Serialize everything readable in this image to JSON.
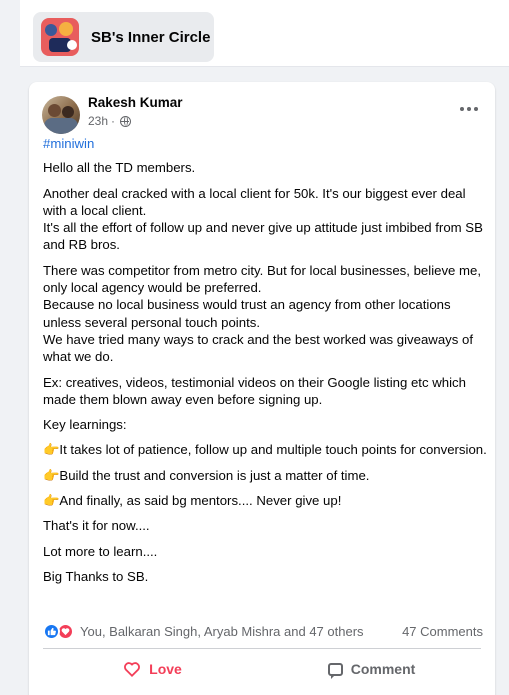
{
  "group": {
    "name": "SB's Inner Circle"
  },
  "post": {
    "author": "Rakesh Kumar",
    "time": "23h",
    "meta_separator": "·",
    "privacy_icon": "globe-icon",
    "hashtag": "#miniwin",
    "paragraphs": [
      "Hello all the TD members.",
      "Another deal cracked with a local client for 50k. It's our biggest ever deal with a local client.\nIt's all the effort of follow up and never give up attitude just imbibed from SB and RB bros.",
      "There was competitor from metro city. But for local businesses, believe me, only local agency would be preferred.\nBecause no local business would trust an agency from other locations unless several personal touch points.\nWe have tried many ways to crack and the best worked was giveaways of what we do.",
      "Ex: creatives, videos, testimonial videos on their Google listing etc which made them blown away even before signing up.",
      "Key learnings:"
    ],
    "points": [
      "It takes lot of patience, follow up and multiple touch points for conversion.",
      "Build the trust and conversion is just a matter of time.",
      "And finally, as said bg mentors.... Never give up!"
    ],
    "closing": [
      "That's it for now....",
      "Lot more to learn....",
      "Big Thanks to SB."
    ],
    "point_icon": "👉"
  },
  "reactions": {
    "types": [
      "like",
      "love"
    ],
    "summary": "You, Balkaran Singh, Aryab Mishra and 47 others",
    "comments": "47 Comments"
  },
  "actions": {
    "love_label": "Love",
    "comment_label": "Comment"
  },
  "colors": {
    "accent_blue": "#1877f2",
    "love_red": "#f33e58",
    "hashtag_blue": "#216fdb",
    "muted_text": "#65676b"
  }
}
